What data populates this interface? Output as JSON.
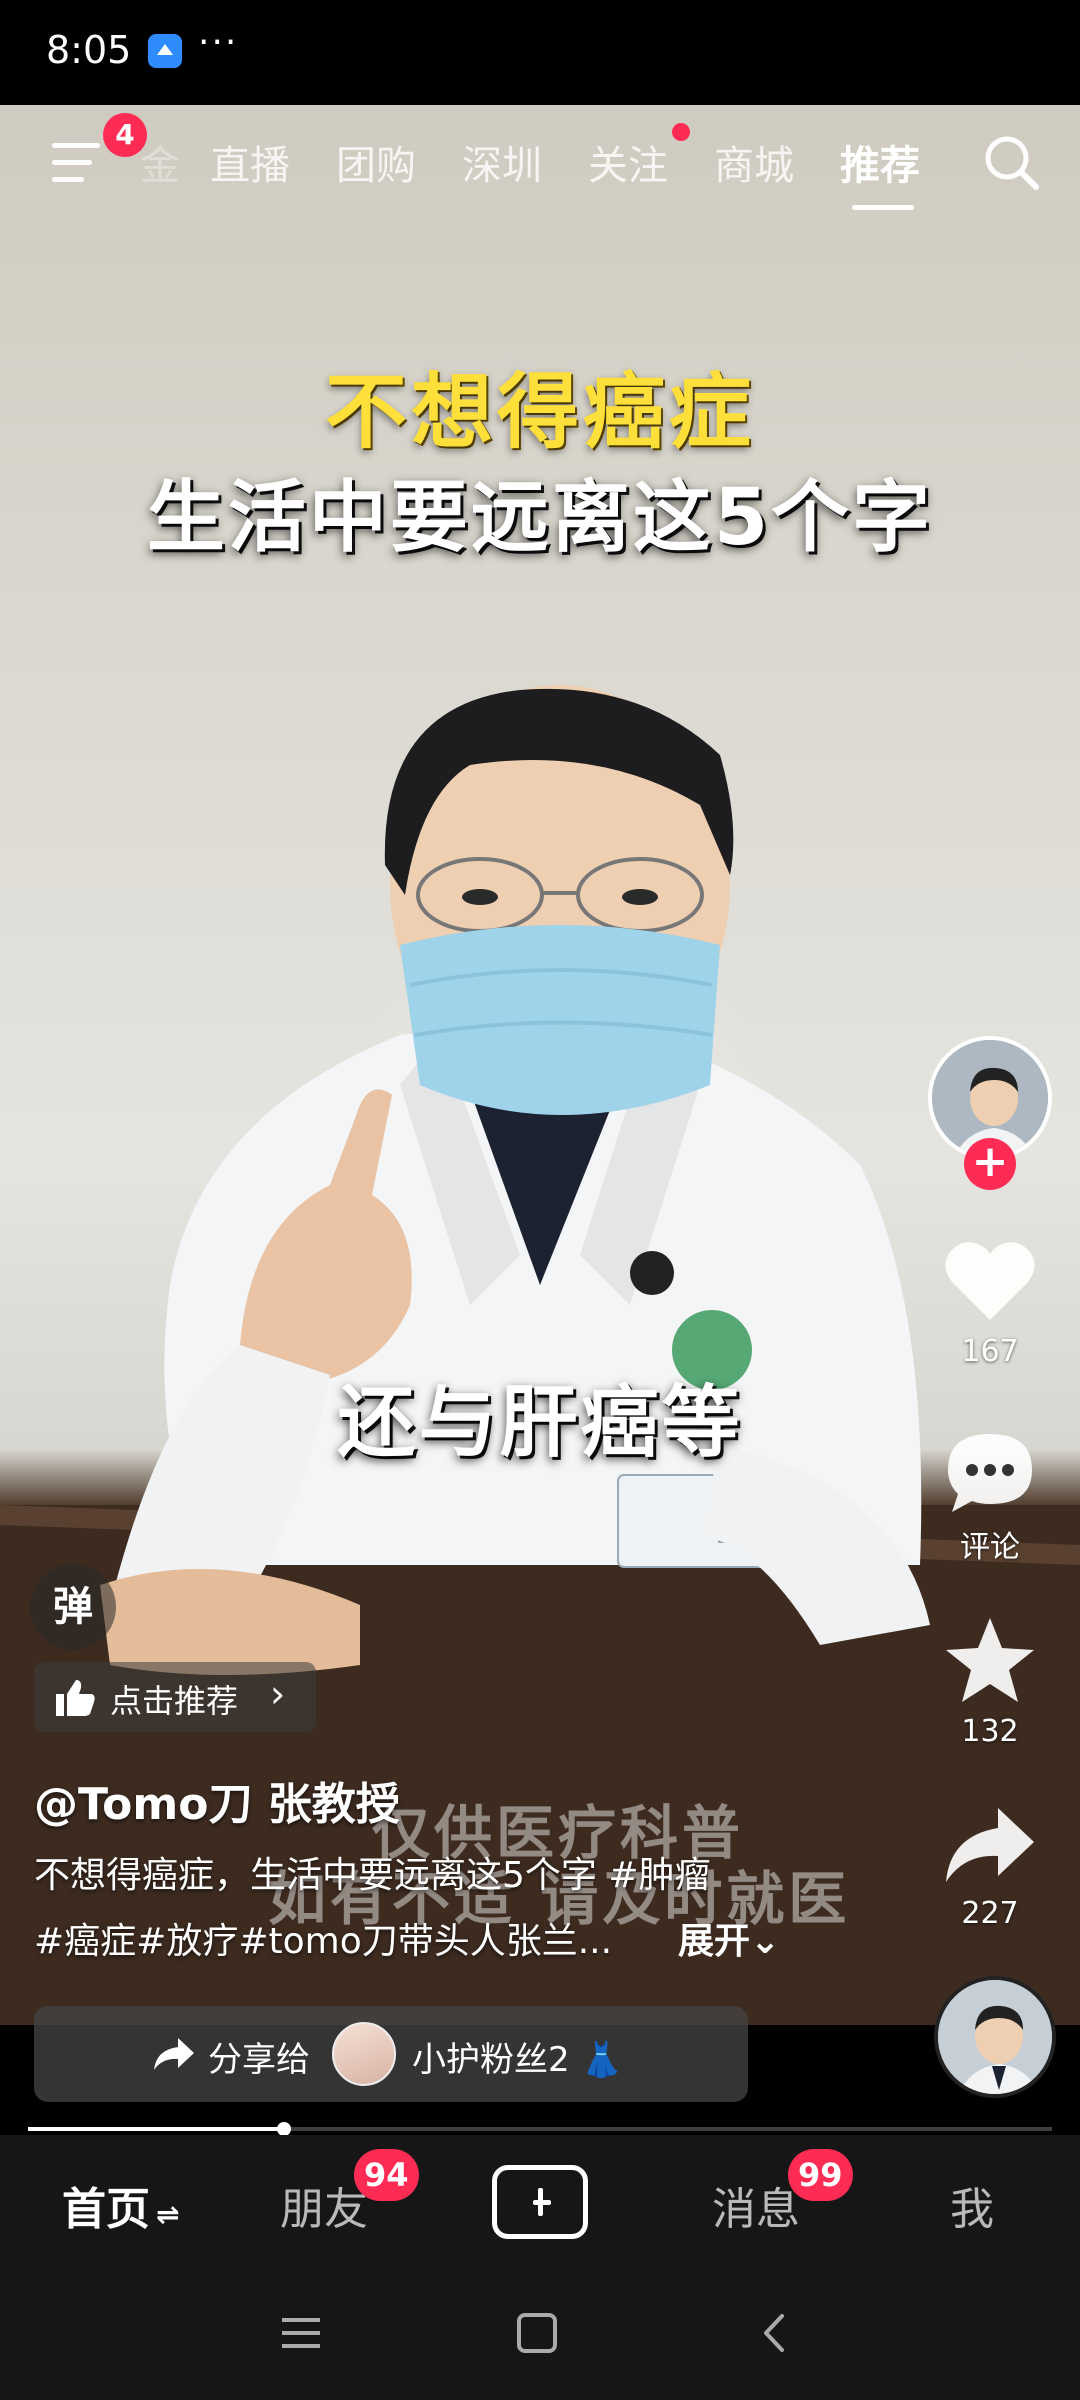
{
  "status_bar": {
    "time": "8:05",
    "more": "···"
  },
  "top_nav": {
    "menu_badge": "4",
    "partial_tab": "金",
    "tabs": [
      {
        "label": "直播"
      },
      {
        "label": "团购"
      },
      {
        "label": "深圳"
      },
      {
        "label": "关注"
      },
      {
        "label": "商城"
      },
      {
        "label": "推荐"
      }
    ],
    "active_tab": "推荐"
  },
  "video": {
    "title_line1": "不想得癌症",
    "title_line2": "生活中要远离这5个字",
    "subtitle": "还与肝癌等",
    "watermark_line1": "仅供医疗科普",
    "watermark_line2": "如有不适 请及时就医"
  },
  "right_rail": {
    "follow": "+",
    "like_count": "167",
    "comment_label": "评论",
    "favorite_count": "132",
    "share_count": "227"
  },
  "danmu_button": "弹",
  "recommend": {
    "label": "点击推荐",
    "arrow": "›"
  },
  "post": {
    "author": "@Tomo刀 张教授",
    "desc_line1": "不想得癌症，生活中要远离这5个字 #肿瘤",
    "desc_line2": "#癌症#放疗#tomo刀带头人张兰...",
    "expand": "展开⌄"
  },
  "share_bar": {
    "label": "分享给",
    "name": "小护粉丝2 👗"
  },
  "progress": {
    "fraction": 0.25
  },
  "tabbar": {
    "home": "首页",
    "home_suffix": "⇌",
    "friends": "朋友",
    "friends_badge": "94",
    "messages": "消息",
    "messages_badge": "99",
    "me": "我"
  },
  "colors": {
    "accent": "#fe2c55",
    "title_yellow": "#ffe03a",
    "tabbar_bg": "#161616"
  }
}
